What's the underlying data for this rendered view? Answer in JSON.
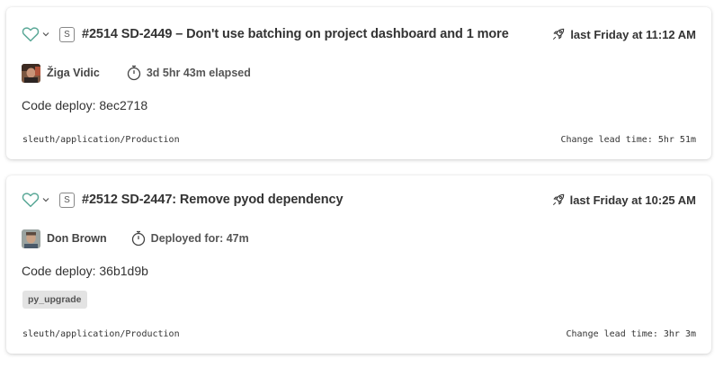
{
  "colors": {
    "heart_accent": "#5aa897",
    "card_background": "#ffffff",
    "tag_background": "#e3e3e3"
  },
  "deployments": [
    {
      "favorite_icon": "heart-outline-icon",
      "size_badge": "S",
      "title": "#2514 SD-2449 – Don't use batching on project dashboard and 1 more",
      "deploy_time_icon": "rocket-icon",
      "deploy_time": "last Friday at 11:12 AM",
      "author": "Žiga Vidic",
      "timer_icon": "stopwatch-icon",
      "timer_text": "3d 5hr 43m elapsed",
      "code_deploy": "Code deploy: 8ec2718",
      "tags": [],
      "environment": "sleuth/application/Production",
      "lead_time": "Change lead time: 5hr 51m"
    },
    {
      "favorite_icon": "heart-outline-icon",
      "size_badge": "S",
      "title": "#2512 SD-2447: Remove pyod dependency",
      "deploy_time_icon": "rocket-icon",
      "deploy_time": "last Friday at 10:25 AM",
      "author": "Don Brown",
      "timer_icon": "stopwatch-icon",
      "timer_text": "Deployed for: 47m",
      "code_deploy": "Code deploy: 36b1d9b",
      "tags": [
        "py_upgrade"
      ],
      "environment": "sleuth/application/Production",
      "lead_time": "Change lead time: 3hr 3m"
    }
  ]
}
